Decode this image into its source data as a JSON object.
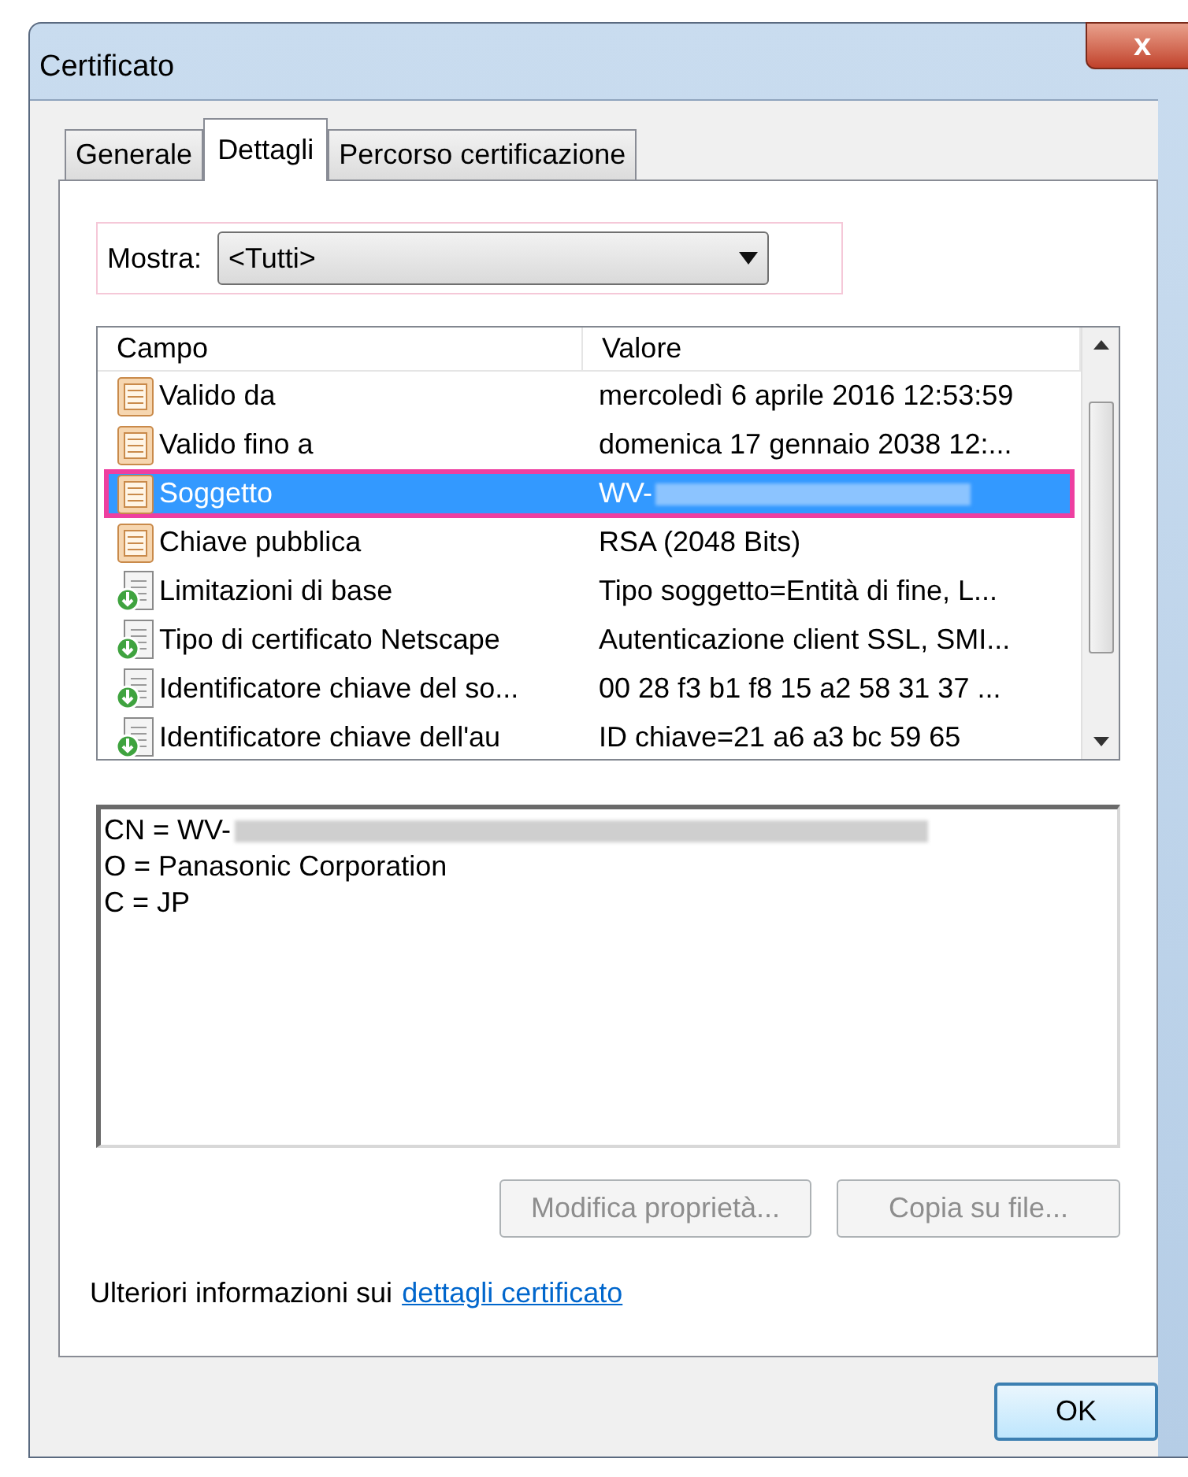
{
  "window": {
    "title": "Certificato",
    "close": "x"
  },
  "tabs": [
    {
      "label": "Generale",
      "selected": false
    },
    {
      "label": "Dettagli",
      "selected": true
    },
    {
      "label": "Percorso certificazione",
      "selected": false
    }
  ],
  "show": {
    "label": "Mostra:",
    "value": "<Tutti>"
  },
  "table": {
    "columns": [
      "Campo",
      "Valore"
    ],
    "rows": [
      {
        "kind": "property",
        "field": "Valido da",
        "value": "mercoledì 6 aprile 2016 12:53:59",
        "selected": false,
        "redacted": false
      },
      {
        "kind": "property",
        "field": "Valido fino a",
        "value": "domenica 17 gennaio 2038 12:...",
        "selected": false,
        "redacted": false
      },
      {
        "kind": "property",
        "field": "Soggetto",
        "value": "WV-",
        "selected": true,
        "redacted": true
      },
      {
        "kind": "property",
        "field": "Chiave pubblica",
        "value": "RSA (2048 Bits)",
        "selected": false,
        "redacted": false
      },
      {
        "kind": "extension",
        "field": "Limitazioni di base",
        "value": "Tipo soggetto=Entità di fine, L...",
        "selected": false,
        "redacted": false
      },
      {
        "kind": "extension",
        "field": "Tipo di certificato Netscape",
        "value": "Autenticazione client SSL, SMI...",
        "selected": false,
        "redacted": false
      },
      {
        "kind": "extension",
        "field": "Identificatore chiave del so...",
        "value": "00 28 f3 b1 f8 15 a2 58 31 37 ...",
        "selected": false,
        "redacted": false
      },
      {
        "kind": "extension",
        "field": "Identificatore chiave dell'au",
        "value": "ID chiave=21 a6 a3 bc 59 65",
        "selected": false,
        "redacted": false
      }
    ]
  },
  "detail_lines": [
    {
      "text": "CN = WV-",
      "redacted": true
    },
    {
      "text": "O = Panasonic Corporation",
      "redacted": false
    },
    {
      "text": "C = JP",
      "redacted": false
    }
  ],
  "buttons": [
    {
      "label": "Modifica proprietà...",
      "disabled": true
    },
    {
      "label": "Copia su file...",
      "disabled": true
    }
  ],
  "info": {
    "text": "Ulteriori informazioni sui",
    "link": "dettagli certificato"
  },
  "ok_button": {
    "label": "OK",
    "disabled": false
  }
}
